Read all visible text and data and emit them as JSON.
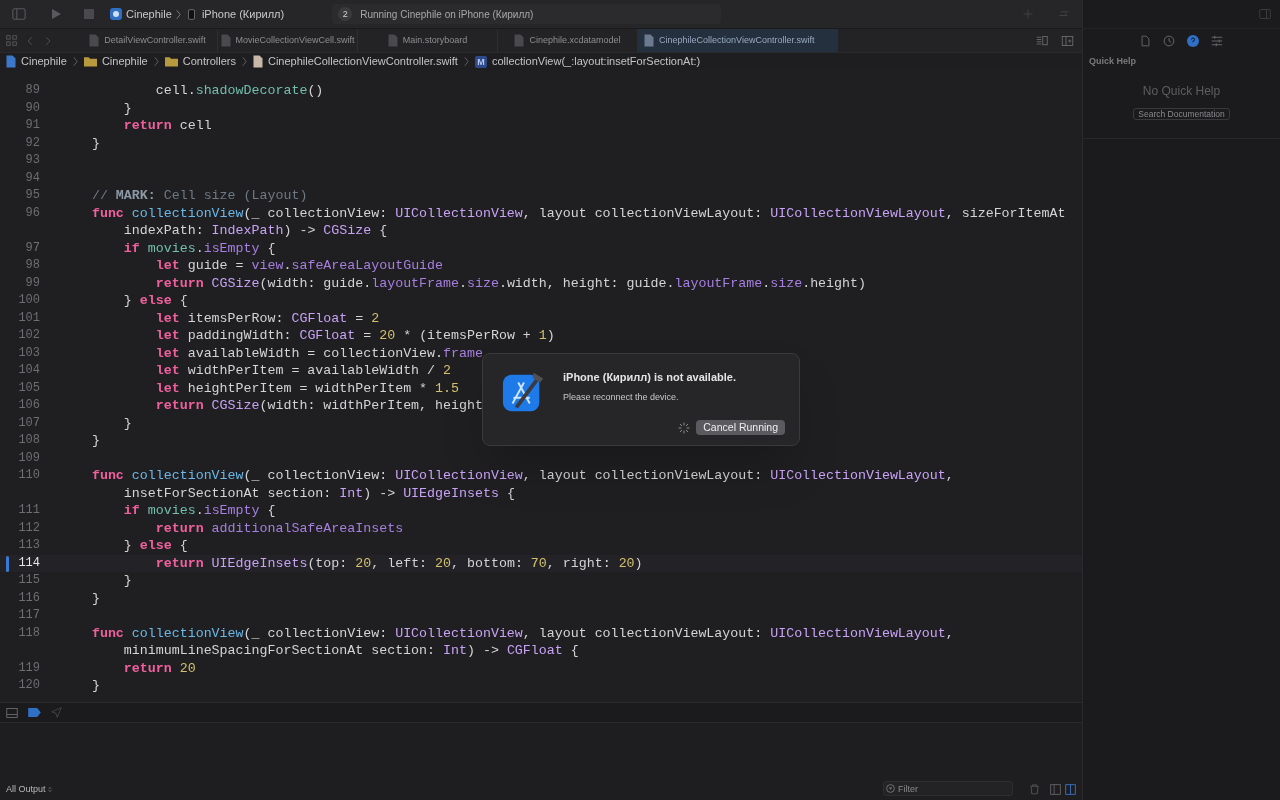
{
  "toolbar": {
    "scheme": "Cinephile",
    "device": "iPhone (Кирилл)",
    "activity_count": "2",
    "activity": "Running Cinephile on iPhone (Кирилл)"
  },
  "tabs": [
    {
      "label": "DetailViewController.swift",
      "selected": false
    },
    {
      "label": "MovieCollectionViewCell.swift",
      "selected": false
    },
    {
      "label": "Main.storyboard",
      "selected": false
    },
    {
      "label": "Cinephile.xcdatamodel",
      "selected": false
    },
    {
      "label": "CinephileCollectionViewController.swift",
      "selected": true
    }
  ],
  "breadcrumb": [
    {
      "kind": "project",
      "label": "Cinephile"
    },
    {
      "kind": "folder",
      "label": "Cinephile"
    },
    {
      "kind": "folder",
      "label": "Controllers"
    },
    {
      "kind": "file",
      "label": "CinephileCollectionViewController.swift"
    },
    {
      "kind": "method",
      "badge": "M",
      "label": "collectionView(_:layout:insetForSectionAt:)"
    }
  ],
  "code": [
    {
      "number": "89",
      "current": false,
      "segments": [
        {
          "kind": "plain",
          "text": "            cell."
        },
        {
          "kind": "project",
          "text": "shadowDecorate"
        },
        {
          "kind": "plain",
          "text": "()"
        }
      ]
    },
    {
      "number": "90",
      "current": false,
      "segments": [
        {
          "kind": "plain",
          "text": "        }"
        }
      ]
    },
    {
      "number": "91",
      "current": false,
      "segments": [
        {
          "kind": "keyword",
          "text": "        return"
        },
        {
          "kind": "plain",
          "text": " cell"
        }
      ]
    },
    {
      "number": "92",
      "current": false,
      "segments": [
        {
          "kind": "plain",
          "text": "    }"
        }
      ]
    },
    {
      "number": "93",
      "current": false
    },
    {
      "number": "94",
      "current": false
    },
    {
      "number": "95",
      "current": false,
      "segments": [
        {
          "kind": "comment",
          "text": "    // "
        },
        {
          "kind": "mark",
          "text": "MARK:"
        },
        {
          "kind": "comment",
          "text": " Cell size (Layout)"
        }
      ]
    },
    {
      "number": "96",
      "current": false,
      "segments": [
        {
          "kind": "keyword",
          "text": "    func "
        },
        {
          "kind": "function",
          "text": "collectionView"
        },
        {
          "kind": "plain",
          "text": "(_ collectionView: "
        },
        {
          "kind": "type",
          "text": "UICollectionView"
        },
        {
          "kind": "plain",
          "text": ", layout collectionViewLayout: "
        },
        {
          "kind": "type",
          "text": "UICollectionViewLayout"
        },
        {
          "kind": "plain",
          "text": ", sizeForItemAt"
        }
      ]
    },
    {
      "current": false,
      "segments": [
        {
          "kind": "plain",
          "text": "        indexPath: "
        },
        {
          "kind": "type",
          "text": "IndexPath"
        },
        {
          "kind": "plain",
          "text": ") -> "
        },
        {
          "kind": "type",
          "text": "CGSize"
        },
        {
          "kind": "plain",
          "text": " {"
        }
      ]
    },
    {
      "number": "97",
      "current": false,
      "segments": [
        {
          "kind": "keyword",
          "text": "        if "
        },
        {
          "kind": "project",
          "text": "movies"
        },
        {
          "kind": "plain",
          "text": "."
        },
        {
          "kind": "system",
          "text": "isEmpty"
        },
        {
          "kind": "plain",
          "text": " {"
        }
      ]
    },
    {
      "number": "98",
      "current": false,
      "segments": [
        {
          "kind": "keyword",
          "text": "            let"
        },
        {
          "kind": "plain",
          "text": " guide = "
        },
        {
          "kind": "system",
          "text": "view"
        },
        {
          "kind": "plain",
          "text": "."
        },
        {
          "kind": "system",
          "text": "safeAreaLayoutGuide"
        }
      ]
    },
    {
      "number": "99",
      "current": false,
      "segments": [
        {
          "kind": "keyword",
          "text": "            return "
        },
        {
          "kind": "type",
          "text": "CGSize"
        },
        {
          "kind": "plain",
          "text": "(width: guide."
        },
        {
          "kind": "system",
          "text": "layoutFrame"
        },
        {
          "kind": "plain",
          "text": "."
        },
        {
          "kind": "system",
          "text": "size"
        },
        {
          "kind": "plain",
          "text": ".width, height: guide."
        },
        {
          "kind": "system",
          "text": "layoutFrame"
        },
        {
          "kind": "plain",
          "text": "."
        },
        {
          "kind": "system",
          "text": "size"
        },
        {
          "kind": "plain",
          "text": ".height)"
        }
      ]
    },
    {
      "number": "100",
      "current": false,
      "segments": [
        {
          "kind": "plain",
          "text": "        } "
        },
        {
          "kind": "keyword",
          "text": "else"
        },
        {
          "kind": "plain",
          "text": " {"
        }
      ]
    },
    {
      "number": "101",
      "current": false,
      "segments": [
        {
          "kind": "keyword",
          "text": "            let"
        },
        {
          "kind": "plain",
          "text": " itemsPerRow: "
        },
        {
          "kind": "type",
          "text": "CGFloat"
        },
        {
          "kind": "plain",
          "text": " = "
        },
        {
          "kind": "number",
          "text": "2"
        }
      ]
    },
    {
      "number": "102",
      "current": false,
      "segments": [
        {
          "kind": "keyword",
          "text": "            let"
        },
        {
          "kind": "plain",
          "text": " paddingWidth: "
        },
        {
          "kind": "type",
          "text": "CGFloat"
        },
        {
          "kind": "plain",
          "text": " = "
        },
        {
          "kind": "number",
          "text": "20"
        },
        {
          "kind": "plain",
          "text": " * (itemsPerRow + "
        },
        {
          "kind": "number",
          "text": "1"
        },
        {
          "kind": "plain",
          "text": ")"
        }
      ]
    },
    {
      "number": "103",
      "current": false,
      "segments": [
        {
          "kind": "keyword",
          "text": "            let"
        },
        {
          "kind": "plain",
          "text": " availableWidth = collectionView."
        },
        {
          "kind": "system",
          "text": "frame"
        }
      ]
    },
    {
      "number": "104",
      "current": false,
      "segments": [
        {
          "kind": "keyword",
          "text": "            let"
        },
        {
          "kind": "plain",
          "text": " widthPerItem = availableWidth / "
        },
        {
          "kind": "number",
          "text": "2"
        }
      ]
    },
    {
      "number": "105",
      "current": false,
      "segments": [
        {
          "kind": "keyword",
          "text": "            let"
        },
        {
          "kind": "plain",
          "text": " heightPerItem = widthPerItem * "
        },
        {
          "kind": "number",
          "text": "1.5"
        }
      ]
    },
    {
      "number": "106",
      "current": false,
      "segments": [
        {
          "kind": "keyword",
          "text": "            return "
        },
        {
          "kind": "type",
          "text": "CGSize"
        },
        {
          "kind": "plain",
          "text": "(width: widthPerItem, height"
        }
      ]
    },
    {
      "number": "107",
      "current": false,
      "segments": [
        {
          "kind": "plain",
          "text": "        }"
        }
      ]
    },
    {
      "number": "108",
      "current": false,
      "segments": [
        {
          "kind": "plain",
          "text": "    }"
        }
      ]
    },
    {
      "number": "109",
      "current": false
    },
    {
      "number": "110",
      "current": false,
      "segments": [
        {
          "kind": "keyword",
          "text": "    func "
        },
        {
          "kind": "function",
          "text": "collectionView"
        },
        {
          "kind": "plain",
          "text": "(_ collectionView: "
        },
        {
          "kind": "type",
          "text": "UICollectionView"
        },
        {
          "kind": "plain",
          "text": ", layout collectionViewLayout: "
        },
        {
          "kind": "type",
          "text": "UICollectionViewLayout"
        },
        {
          "kind": "plain",
          "text": ","
        }
      ]
    },
    {
      "current": false,
      "segments": [
        {
          "kind": "plain",
          "text": "        insetForSectionAt section: "
        },
        {
          "kind": "type",
          "text": "Int"
        },
        {
          "kind": "plain",
          "text": ") -> "
        },
        {
          "kind": "type",
          "text": "UIEdgeInsets"
        },
        {
          "kind": "plain",
          "text": " {"
        }
      ]
    },
    {
      "number": "111",
      "current": false,
      "segments": [
        {
          "kind": "keyword",
          "text": "        if "
        },
        {
          "kind": "project",
          "text": "movies"
        },
        {
          "kind": "plain",
          "text": "."
        },
        {
          "kind": "system",
          "text": "isEmpty"
        },
        {
          "kind": "plain",
          "text": " {"
        }
      ]
    },
    {
      "number": "112",
      "current": false,
      "segments": [
        {
          "kind": "keyword",
          "text": "            return "
        },
        {
          "kind": "system",
          "text": "additionalSafeAreaInsets"
        }
      ]
    },
    {
      "number": "113",
      "current": false,
      "segments": [
        {
          "kind": "plain",
          "text": "        } "
        },
        {
          "kind": "keyword",
          "text": "else"
        },
        {
          "kind": "plain",
          "text": " {"
        }
      ]
    },
    {
      "number": "114",
      "current": true,
      "segments": [
        {
          "kind": "keyword",
          "text": "            return "
        },
        {
          "kind": "type",
          "text": "UIEdgeInsets"
        },
        {
          "kind": "plain",
          "text": "(top: "
        },
        {
          "kind": "number",
          "text": "20"
        },
        {
          "kind": "plain",
          "text": ", left: "
        },
        {
          "kind": "number",
          "text": "20"
        },
        {
          "kind": "plain",
          "text": ", bottom: "
        },
        {
          "kind": "number",
          "text": "70"
        },
        {
          "kind": "plain",
          "text": ", right: "
        },
        {
          "kind": "number",
          "text": "20"
        },
        {
          "kind": "plain",
          "text": ")"
        }
      ]
    },
    {
      "number": "115",
      "current": false,
      "segments": [
        {
          "kind": "plain",
          "text": "        }"
        }
      ]
    },
    {
      "number": "116",
      "current": false,
      "segments": [
        {
          "kind": "plain",
          "text": "    }"
        }
      ]
    },
    {
      "number": "117",
      "current": false
    },
    {
      "number": "118",
      "current": false,
      "segments": [
        {
          "kind": "keyword",
          "text": "    func "
        },
        {
          "kind": "function",
          "text": "collectionView"
        },
        {
          "kind": "plain",
          "text": "(_ collectionView: "
        },
        {
          "kind": "type",
          "text": "UICollectionView"
        },
        {
          "kind": "plain",
          "text": ", layout collectionViewLayout: "
        },
        {
          "kind": "type",
          "text": "UICollectionViewLayout"
        },
        {
          "kind": "plain",
          "text": ","
        }
      ]
    },
    {
      "current": false,
      "segments": [
        {
          "kind": "plain",
          "text": "        minimumLineSpacingForSectionAt section: "
        },
        {
          "kind": "type",
          "text": "Int"
        },
        {
          "kind": "plain",
          "text": ") -> "
        },
        {
          "kind": "type",
          "text": "CGFloat"
        },
        {
          "kind": "plain",
          "text": " {"
        }
      ]
    },
    {
      "number": "119",
      "current": false,
      "segments": [
        {
          "kind": "keyword",
          "text": "        return "
        },
        {
          "kind": "number",
          "text": "20"
        }
      ]
    },
    {
      "number": "120",
      "current": false,
      "segments": [
        {
          "kind": "plain",
          "text": "    }"
        }
      ]
    }
  ],
  "dialog": {
    "title": "iPhone (Кирилл) is not available.",
    "message": "Please reconnect the device.",
    "button": "Cancel Running"
  },
  "console": {
    "scope": "All Output",
    "filter_placeholder": "Filter"
  },
  "quick_help": {
    "title": "Quick Help",
    "empty": "No Quick Help",
    "button": "Search Documentation"
  }
}
